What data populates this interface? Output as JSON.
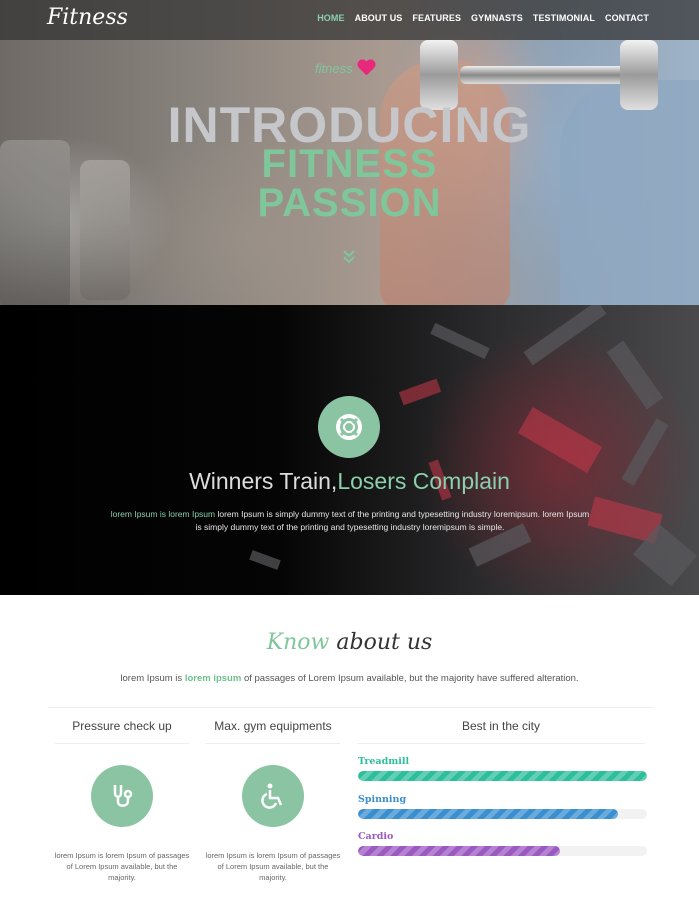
{
  "brand": "Fitness",
  "nav": [
    "HOME",
    "ABOUT US",
    "FEATURES",
    "GYMNASTS",
    "TESTIMONIAL",
    "CONTACT"
  ],
  "hero": {
    "logo_text": "fitness",
    "line1": "INTRODUCING",
    "line2": "FITNESS",
    "line3": "PASSION"
  },
  "motto": {
    "part1": "Winners Train,",
    "part2": "Losers Complain",
    "para_green": "lorem Ipsum is lorem Ipsum",
    "para_rest": " lorem Ipsum is simply dummy text of the printing and typesetting industry loremipsum. lorem Ipsum is simply dummy text of the printing and typesetting industry loremipsum is simple."
  },
  "about": {
    "title_green": "Know",
    "title_rest": " about us",
    "sub_pre": "lorem Ipsum is ",
    "sub_bold": "lorem ipsum",
    "sub_post": " of passages of Lorem Ipsum available, but the majority have suffered alteration.",
    "col1_title": "Pressure check up",
    "col2_title": "Max. gym equipments",
    "col3_title": "Best in the city",
    "col_text": "lorem Ipsum is lorem Ipsum of passages of Lorem Ipsum available, but the majority.",
    "icons": [
      "stethoscope-icon",
      "wheelchair-icon"
    ]
  },
  "skills": [
    {
      "label": "Treadmill",
      "percent": 100,
      "color": "#2dbf9b",
      "track": "#1f9f7f"
    },
    {
      "label": "Spinning",
      "percent": 90,
      "color": "#3a8fd1",
      "track": "#2a72ad"
    },
    {
      "label": "Cardio",
      "percent": 70,
      "color": "#9b59c2",
      "track": "#8d47b8"
    }
  ],
  "colors": {
    "accent": "#8bc4a3",
    "dark": "#000000"
  }
}
